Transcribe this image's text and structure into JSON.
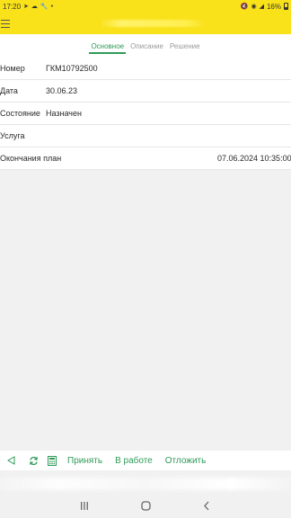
{
  "status_bar": {
    "time": "17:20",
    "battery": "16%"
  },
  "header": {
    "menu_icon": "hamburger-icon"
  },
  "tabs": [
    {
      "label": "Основное",
      "active": true
    },
    {
      "label": "Описание",
      "active": false
    },
    {
      "label": "Решение",
      "active": false
    }
  ],
  "fields": [
    {
      "label": "Номер",
      "value": "ГКМ10792500"
    },
    {
      "label": "Дата",
      "value": "30.06.23"
    },
    {
      "label": "Состояние",
      "value": "Назначен"
    },
    {
      "label": "Услуга",
      "value": ""
    },
    {
      "label": "Окончания план",
      "value": "07.06.2024 10:35:00"
    }
  ],
  "actions": {
    "icons": [
      "back-triangle-icon",
      "refresh-icon",
      "calculator-icon"
    ],
    "buttons": [
      "Принять",
      "В работе",
      "Отложить"
    ]
  },
  "colors": {
    "accent": "#2e9b58",
    "header": "#f9e21a"
  },
  "nav": [
    "recent-apps-icon",
    "home-icon",
    "back-icon"
  ]
}
